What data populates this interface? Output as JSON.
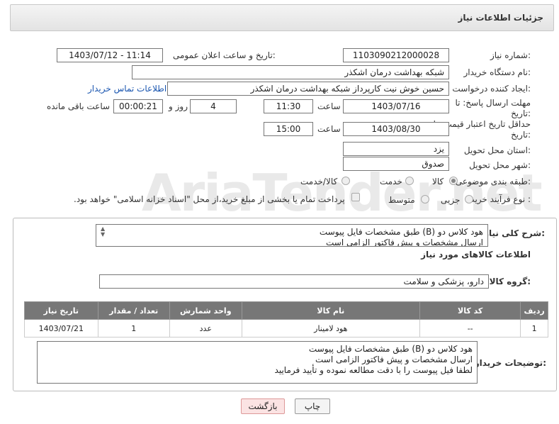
{
  "header": {
    "title": "جزئیات اطلاعات نیاز"
  },
  "fields": {
    "need_number_label": "شماره نیاز:",
    "need_number": "1103090212000028",
    "announce_label": "تاریخ و ساعت اعلان عمومی:",
    "announce_value": "1403/07/12 - 11:14",
    "buyer_org_label": "نام دستگاه خریدار:",
    "buyer_org": "شبکه بهداشت درمان اشکذر",
    "requester_label": "ایجاد کننده درخواست:",
    "requester": "حسین خوش نیت کارپرداز شبکه بهداشت درمان اشکذر",
    "contact_link": "اطلاعات تماس خریدار",
    "deadline_label_1": "مهلت ارسال پاسخ: تا",
    "deadline_label_2": "تاریخ:",
    "deadline_date": "1403/07/16",
    "time_label": "ساعت",
    "deadline_time": "11:30",
    "days_value": "4",
    "days_label": "روز و",
    "remaining_time": "00:00:21",
    "remaining_label": "ساعت باقی مانده",
    "validity_label_1": "حداقل تاریخ اعتبار قیمت: تا",
    "validity_label_2": "تاریخ:",
    "validity_date": "1403/08/30",
    "validity_time_label": "ساعت",
    "validity_time": "15:00",
    "province_label": "استان محل تحویل:",
    "province": "یزد",
    "city_label": "شهر محل تحویل:",
    "city": "صدوق",
    "category_label": "طبقه بندی موضوعی:",
    "category_options": [
      "کالا",
      "خدمت",
      "کالا/خدمت"
    ],
    "category_selected": "کالا",
    "process_label": "نوع فرآیند خرید :",
    "process_options": [
      "جزیی",
      "متوسط"
    ],
    "process_note": "پرداخت تمام یا بخشی از مبلغ خرید،از محل \"اسناد خزانه اسلامی\" خواهد بود."
  },
  "details": {
    "summary_label": "شرح کلی نیاز:",
    "summary_lines": [
      "هود کلاس دو (B) طبق مشخصات فایل پیوست",
      "ارسال مشخصات و پیش فاکتور الزامی است"
    ],
    "goods_info_title": "اطلاعات کالاهای مورد نیاز",
    "goods_group_label": "گروه کالا:",
    "goods_group": "دارو، پزشکی و سلامت",
    "table": {
      "headers": [
        "ردیف",
        "کد کالا",
        "نام کالا",
        "واحد شمارش",
        "تعداد / مقدار",
        "تاریخ نیاز"
      ],
      "rows": [
        [
          "1",
          "--",
          "هود لامینار",
          "عدد",
          "1",
          "1403/07/21"
        ]
      ]
    },
    "buyer_notes_label": "توضیحات خریدار:",
    "buyer_notes_lines": [
      "هود کلاس دو (B) طبق مشخصات فایل پیوست",
      "ارسال مشخصات و پیش فاکتور الزامی است",
      "لطفا فیل پیوست را با دقت مطالعه نموده و تأیید فرمایید"
    ]
  },
  "buttons": {
    "print": "چاپ",
    "back": "بازگشت"
  },
  "watermark": "AriaTender.net",
  "colors": {
    "back_button_bg": "#fbe3e3",
    "back_button_border": "#d99",
    "link": "#1a56b0",
    "table_header": "#777777"
  }
}
